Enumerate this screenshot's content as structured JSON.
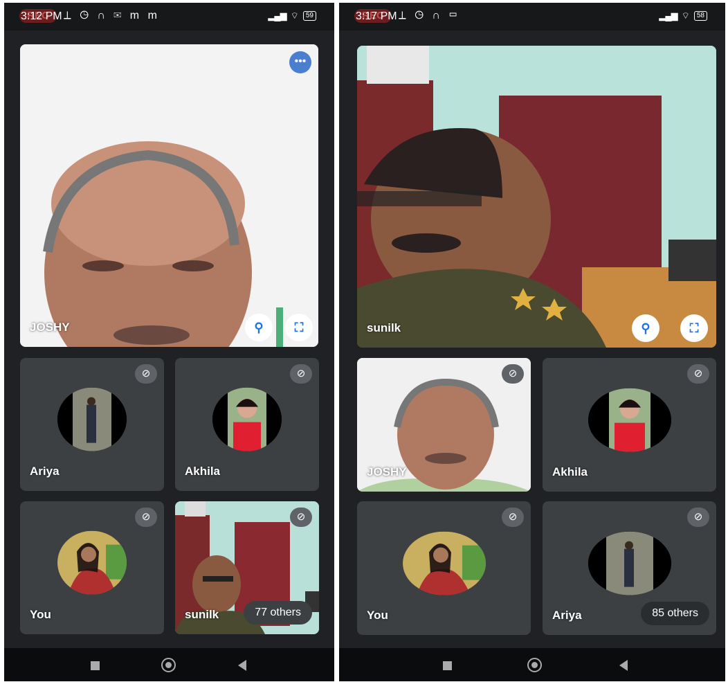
{
  "left": {
    "status": {
      "rec": "REC",
      "time": "3:12 PM",
      "icons": "⟂ ◷ ∩ ✉ m m",
      "battery": "59"
    },
    "main_tile": {
      "name": "JOSHY"
    },
    "tiles": [
      {
        "name": "Ariya"
      },
      {
        "name": "Akhila"
      },
      {
        "name": "You"
      },
      {
        "name": "sunilk",
        "others": "77 others"
      }
    ]
  },
  "right": {
    "status": {
      "rec": "REC",
      "time": "3:17 PM",
      "icons": "⟂ ◷ ∩ ▭",
      "battery": "58"
    },
    "main_tile": {
      "name": "sunilk"
    },
    "tiles": [
      {
        "name": "JOSHY"
      },
      {
        "name": "Akhila"
      },
      {
        "name": "You"
      },
      {
        "name": "Ariya",
        "others": "85 others"
      }
    ]
  },
  "icons": {
    "mic_off": "🎙",
    "pin": "📌",
    "fullscreen": "⛶",
    "more": "•••"
  },
  "colors": {
    "tile_bg": "#3c4043",
    "app_bg": "#202124",
    "accent": "#1a73e8"
  }
}
